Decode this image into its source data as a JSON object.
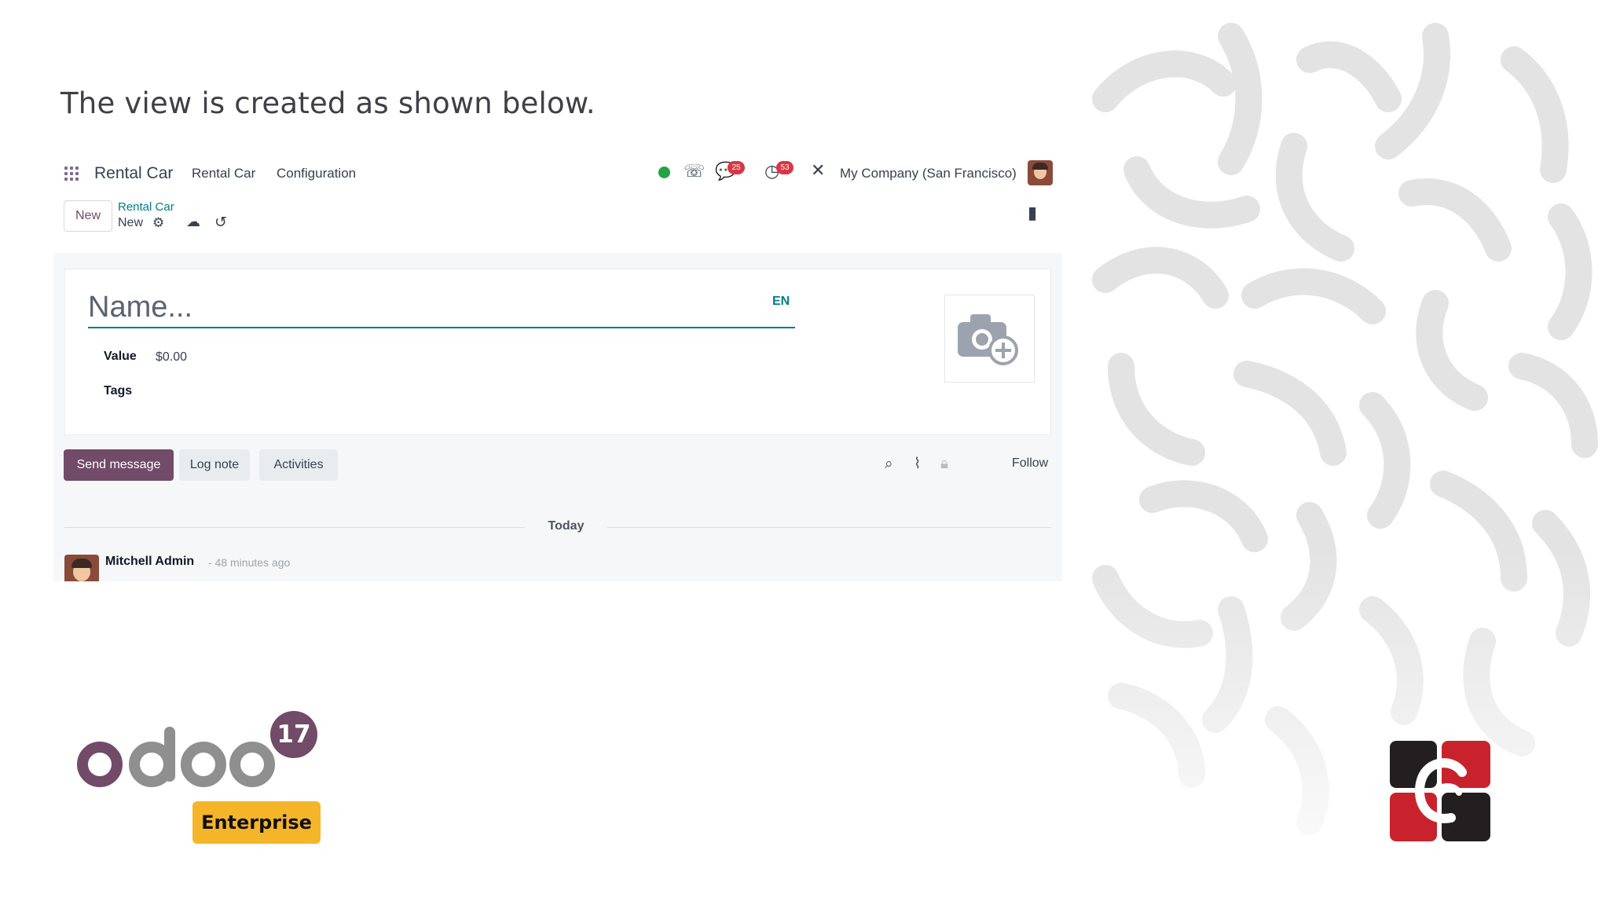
{
  "caption": "The view is created as shown below.",
  "topbar": {
    "app_name": "Rental Car",
    "menu": [
      "Rental Car",
      "Configuration"
    ],
    "chat_badge": "25",
    "activity_badge": "53",
    "company": "My Company (San Francisco)"
  },
  "control": {
    "new_label": "New",
    "breadcrumb_parent": "Rental Car",
    "breadcrumb_current": "New"
  },
  "form": {
    "name_placeholder": "Name...",
    "lang": "EN",
    "fields": [
      {
        "label": "Value",
        "value": "$0.00"
      },
      {
        "label": "Tags",
        "value": ""
      }
    ]
  },
  "chatter": {
    "send_message": "Send message",
    "log_note": "Log note",
    "activities": "Activities",
    "follow": "Follow",
    "today": "Today",
    "message_author": "Mitchell Admin",
    "message_time": "- 48 minutes ago"
  },
  "branding": {
    "version": "17",
    "edition": "Enterprise",
    "odoo_purple": "#714b67",
    "odoo_grey": "#8f8f8f",
    "enterprise_color": "#f5b529",
    "cy_red": "#c8232c",
    "cy_dark": "#231f20"
  }
}
